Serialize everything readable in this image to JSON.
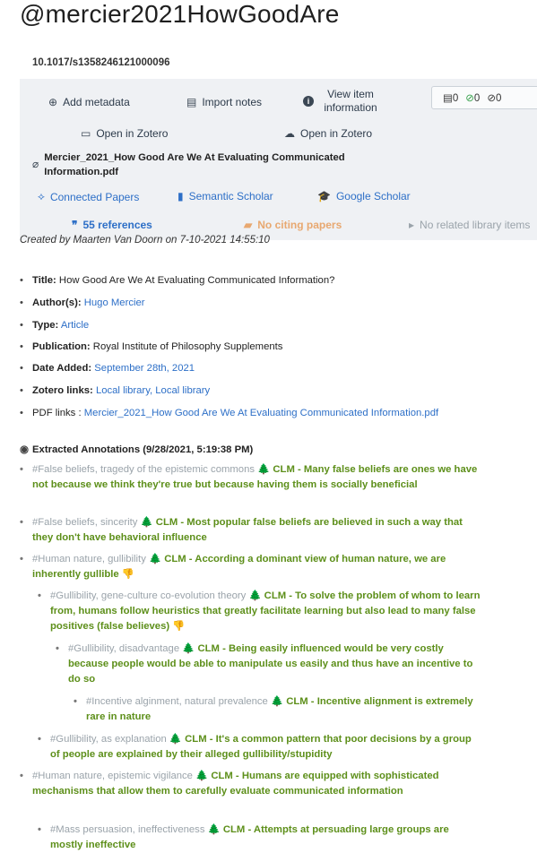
{
  "header": {
    "title": "@mercier2021HowGoodAre",
    "doi": "10.1017/s1358246121000096"
  },
  "panel": {
    "add_metadata": "Add metadata",
    "import_notes": "Import notes",
    "view_item_info": "View item information",
    "stats": {
      "notes": "0",
      "checks": "0",
      "circles": "0"
    },
    "open_zotero_1": "Open in Zotero",
    "open_zotero_2": "Open in Zotero",
    "pdf_name": "Mercier_2021_How Good Are We At Evaluating Communicated Information.pdf",
    "connected_papers": "Connected Papers",
    "semantic_scholar": "Semantic Scholar",
    "google_scholar": "Google Scholar",
    "references": "55 references",
    "citing": "No citing papers",
    "related": "No related library items"
  },
  "created": "Created by Maarten Van Doorn on 7-10-2021 14:55:10",
  "metadata": [
    {
      "key": "Title:",
      "value": "How Good Are We At Evaluating Communicated Information?",
      "link": false
    },
    {
      "key": "Author(s):",
      "value": "Hugo Mercier",
      "link": true
    },
    {
      "key": "Type:",
      "value": "Article",
      "link": true
    },
    {
      "key": "Publication:",
      "value": "Royal Institute of Philosophy Supplements",
      "link": false
    },
    {
      "key": "Date Added:",
      "value": "September 28th, 2021",
      "link": true
    },
    {
      "key": "Zotero links:",
      "value": "Local library, Local library",
      "link": true
    }
  ],
  "pdf_links": {
    "label": "PDF links :",
    "value": "Mercier_2021_How Good Are We At Evaluating Communicated Information.pdf"
  },
  "annotations_header": "Extracted Annotations (9/28/2021, 5:19:38 PM)",
  "annotations": [
    {
      "tag": "#False beliefs, tragedy of the epistemic commons",
      "text": "CLM - Many false beliefs are ones we have not because we think they're true but because having them is socially beneficial"
    },
    {
      "tag": "#False beliefs, sincerity",
      "text": "CLM - Most popular false beliefs are believed in such a way that they don't have behavioral influence"
    },
    {
      "tag": "#Human nature, gullibility",
      "text": "CLM - According a dominant view of human nature, we are inherently gullible"
    },
    {
      "tag": "#Gullibility, gene-culture co-evolution theory",
      "text": "CLM - To solve the problem of whom to learn from, humans follow heuristics that greatly facilitate learning but also lead to many false positives (false believes)"
    },
    {
      "tag": "#Gullibility, disadvantage",
      "text": "CLM - Being easily influenced would be very costly because people would be able to manipulate us easily and thus have an incentive to do so"
    },
    {
      "tag": "#Incentive alginment, natural prevalence",
      "text": "CLM - Incentive alignment is extremely rare in nature"
    },
    {
      "tag": "#Gullibility, as explanation",
      "text": "CLM - It's a common pattern that poor decisions by a group of people are explained by their alleged gullibility/stupidity"
    },
    {
      "tag": "#Human nature, epistemic vigilance",
      "text": "CLM - Humans are equipped with sophisticated mechanisms that allow them to carefully evaluate communicated information"
    },
    {
      "tag": "#Mass persuasion, ineffectiveness",
      "text": "CLM - Attempts at persuading large groups are mostly ineffective"
    }
  ],
  "icons": {
    "tree": "🌲",
    "thumb": "👎"
  }
}
